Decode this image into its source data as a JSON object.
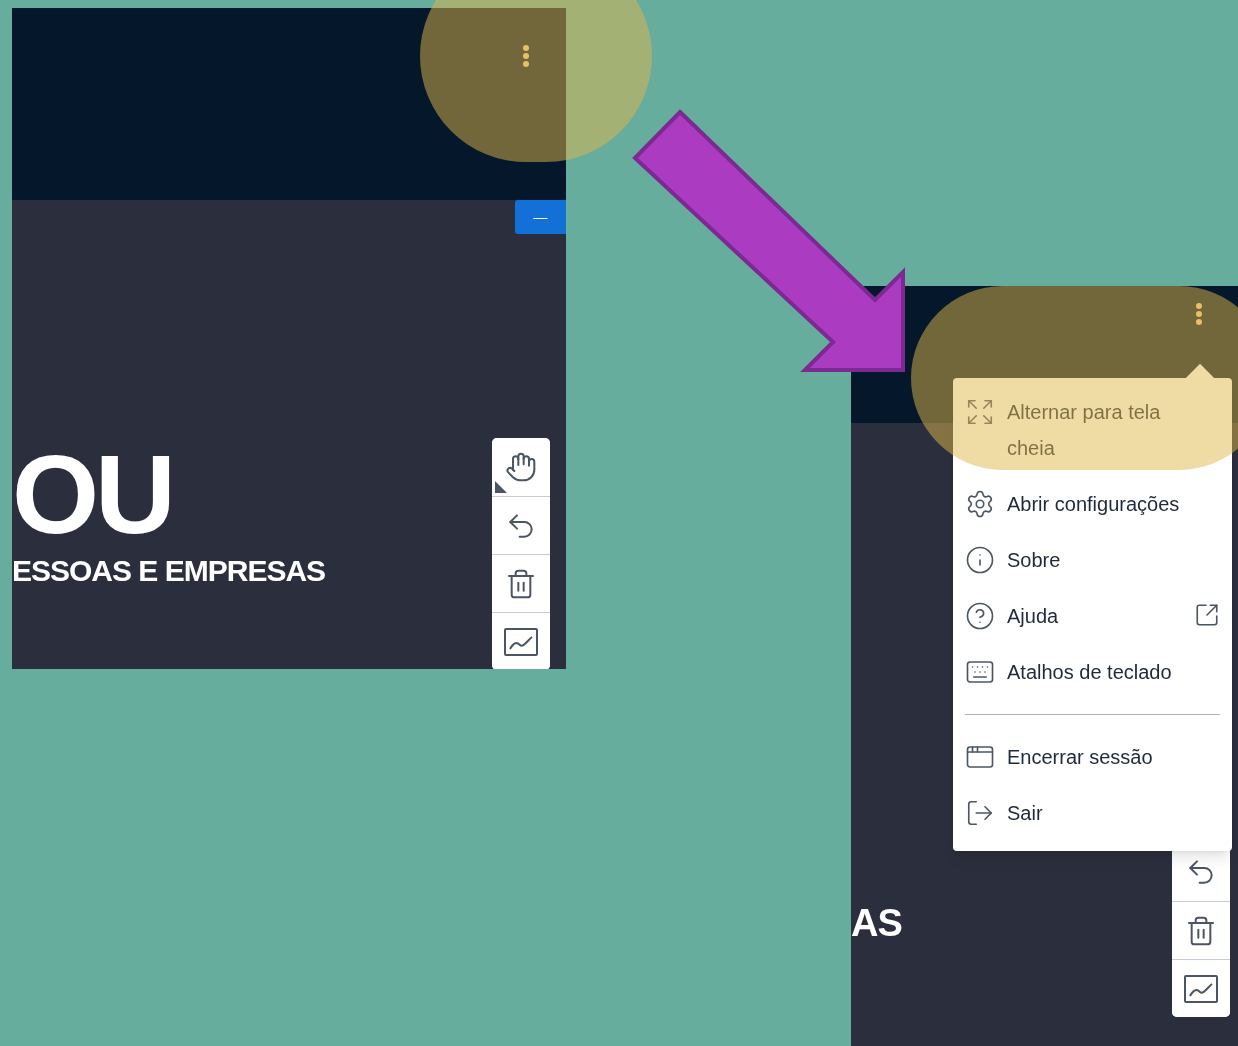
{
  "panels": [
    {
      "logo_title": "OU",
      "logo_subtitle": "ESSOAS E EMPRESAS",
      "minimize_label": "—"
    },
    {
      "logo_subtitle": "AS",
      "menu": {
        "groups": [
          [
            {
              "label": "Alternar para tela cheia",
              "external": false
            },
            {
              "label": "Abrir configurações",
              "external": false
            },
            {
              "label": "Sobre",
              "external": false
            },
            {
              "label": "Ajuda",
              "external": true
            },
            {
              "label": "Atalhos de teclado",
              "external": false
            }
          ],
          [
            {
              "label": "Encerrar sessão",
              "external": false
            },
            {
              "label": "Sair",
              "external": false
            }
          ]
        ]
      }
    }
  ]
}
